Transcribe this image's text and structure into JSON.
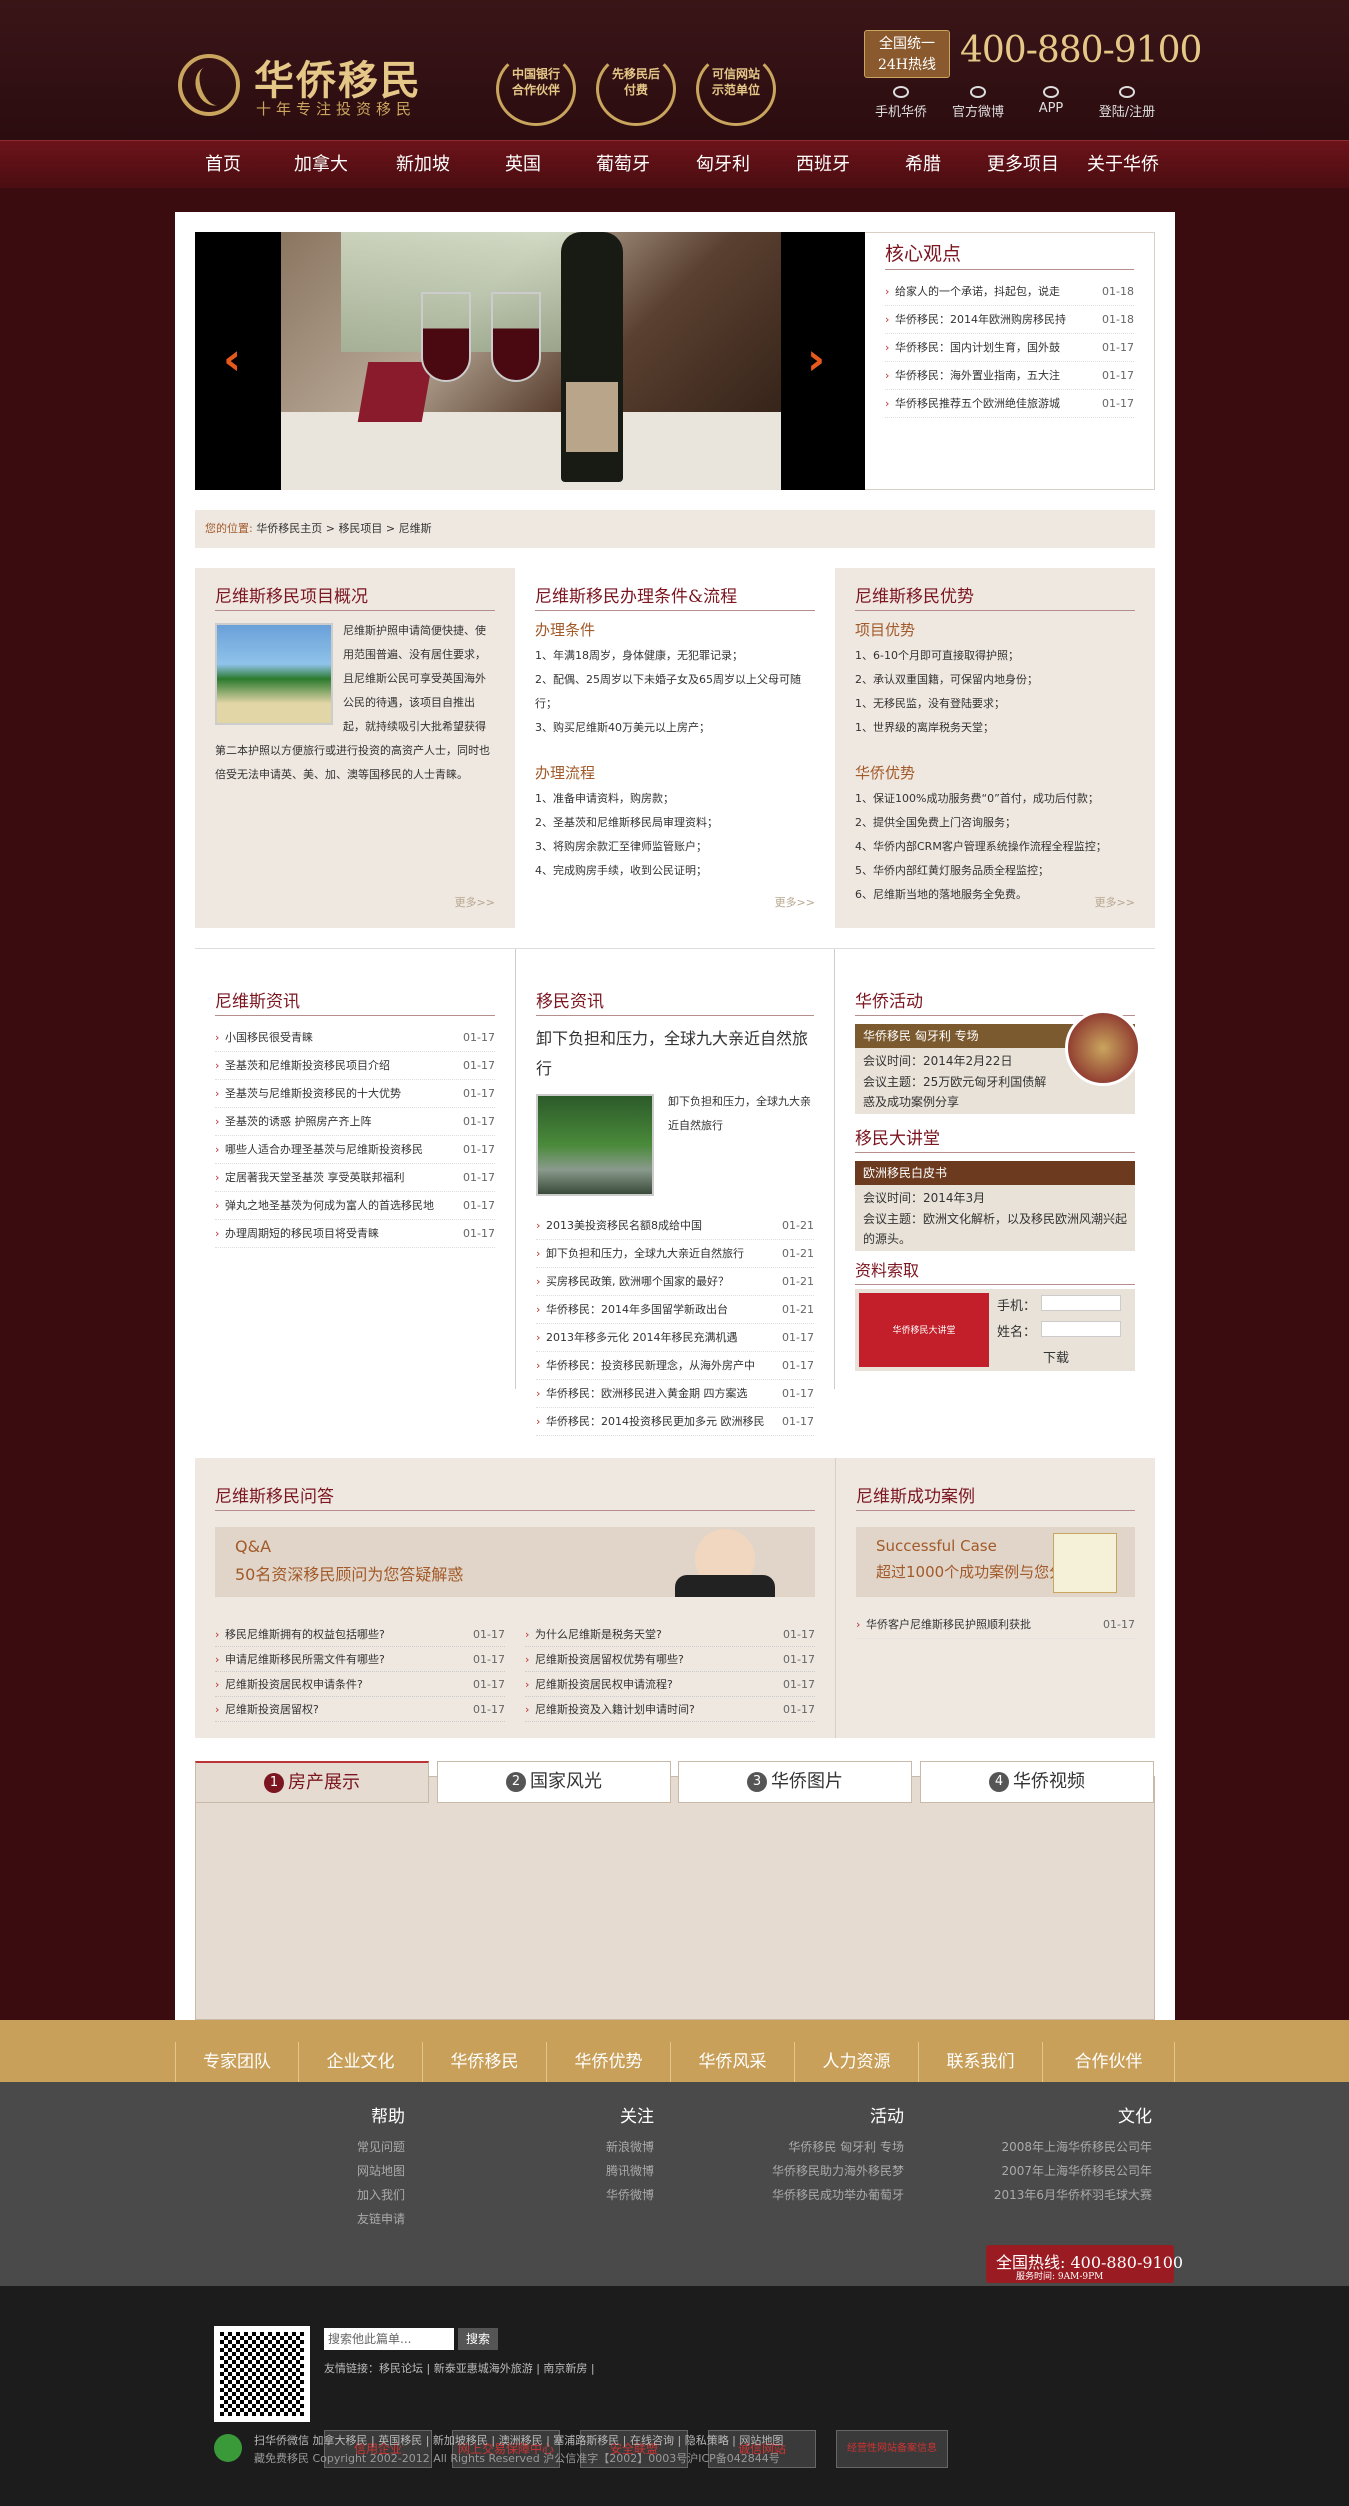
{
  "header": {
    "logo_title": "华侨移民",
    "logo_sub": "十年专注投资移民",
    "badges": [
      "中国银行合作伙伴",
      "先移民后付费",
      "可信网站示范单位"
    ],
    "hotline_label": "全国统一 24H热线",
    "hotline": "400-880-9100",
    "links": [
      "手机华侨",
      "官方微博",
      "APP",
      "登陆/注册"
    ]
  },
  "nav": [
    "首页",
    "加拿大",
    "新加坡",
    "英国",
    "葡萄牙",
    "匈牙利",
    "西班牙",
    "希腊",
    "更多项目",
    "关于华侨"
  ],
  "core": {
    "title": "核心观点",
    "items": [
      {
        "t": "给家人的一个承诺，抖起包，说走",
        "d": "01-18"
      },
      {
        "t": "华侨移民：2014年欧洲购房移民持",
        "d": "01-18"
      },
      {
        "t": "华侨移民：国内计划生育，国外鼓",
        "d": "01-17"
      },
      {
        "t": "华侨移民：海外置业指南，五大注",
        "d": "01-17"
      },
      {
        "t": "华侨移民推荐五个欧洲绝佳旅游城",
        "d": "01-17"
      }
    ]
  },
  "crumb": {
    "label": "您的位置:",
    "path": [
      "华侨移民主页",
      "移民项目",
      "尼维斯"
    ]
  },
  "overview": {
    "title": "尼维斯移民项目概况",
    "text": "尼维斯护照申请简便快捷、使用范围普遍、没有居住要求，且尼维斯公民可享受英国海外公民的待遇，该项目自推出起，就持续吸引大批希望获得第二本护照以方便旅行或进行投资的高资产人士，同时也倍受无法申请英、美、加、澳等国移民的人士青睐。",
    "more": "更多>>"
  },
  "conditions": {
    "title": "尼维斯移民办理条件&流程",
    "sub1": "办理条件",
    "cond": [
      "1、年满18周岁，身体健康，无犯罪记录；",
      "2、配偶、25周岁以下未婚子女及65周岁以上父母可随行；",
      "3、购买尼维斯40万美元以上房产；"
    ],
    "sub2": "办理流程",
    "flow": [
      "1、准备申请资料，购房款；",
      "2、圣基茨和尼维斯移民局审理资料；",
      "3、将购房余款汇至律师监管账户；",
      "4、完成购房手续，收到公民证明；"
    ],
    "more": "更多>>"
  },
  "advantages": {
    "title": "尼维斯移民优势",
    "sub1": "项目优势",
    "proj": [
      "1、6-10个月即可直接取得护照；",
      "2、承认双重国籍，可保留内地身份；",
      "1、无移民监，没有登陆要求；",
      "1、世界级的离岸税务天堂；"
    ],
    "sub2": "华侨优势",
    "qiao": [
      "1、保证100%成功服务费“0”首付，成功后付款；",
      "2、提供全国免费上门咨询服务；",
      "4、华侨内部CRM客户管理系统操作流程全程监控；",
      "5、华侨内部红黄灯服务品质全程监控；",
      "6、尼维斯当地的落地服务全免费。"
    ],
    "more": "更多>>"
  },
  "nevis_news": {
    "title": "尼维斯资讯",
    "items": [
      {
        "t": "小国移民很受青睐",
        "d": "01-17"
      },
      {
        "t": "圣基茨和尼维斯投资移民项目介绍",
        "d": "01-17"
      },
      {
        "t": "圣基茨与尼维斯投资移民的十大优势",
        "d": "01-17"
      },
      {
        "t": "圣基茨的诱惑 护照房产齐上阵",
        "d": "01-17"
      },
      {
        "t": "哪些人适合办理圣基茨与尼维斯投资移民",
        "d": "01-17"
      },
      {
        "t": "定居著我天堂圣基茨 享受英联邦福利",
        "d": "01-17"
      },
      {
        "t": "弹丸之地圣基茨为何成为富人的首选移民地",
        "d": "01-17"
      },
      {
        "t": "办理周期短的移民项目将受青睐",
        "d": "01-17"
      }
    ]
  },
  "immig_news": {
    "title": "移民资讯",
    "headline": "卸下负担和压力，全球九大亲近自然旅行",
    "summary": "卸下负担和压力，全球九大亲近自然旅行",
    "items": [
      {
        "t": "2013美投资移民名额8成给中国",
        "d": "01-21"
      },
      {
        "t": "卸下负担和压力，全球九大亲近自然旅行",
        "d": "01-21"
      },
      {
        "t": "买房移民政策, 欧洲哪个国家的最好？",
        "d": "01-21"
      },
      {
        "t": "华侨移民：2014年多国留学新政出台",
        "d": "01-21"
      },
      {
        "t": "2013年移多元化 2014年移民充满机遇",
        "d": "01-17"
      },
      {
        "t": "华侨移民：投资移民新理念，从海外房产中",
        "d": "01-17"
      },
      {
        "t": "华侨移民：欧洲移民进入黄金期 四方案选",
        "d": "01-17"
      },
      {
        "t": "华侨移民：2014投资移民更加多元 欧洲移民",
        "d": "01-17"
      }
    ]
  },
  "activity": {
    "title": "华侨活动",
    "head": "华侨移民 匈牙利 专场",
    "time": "会议时间：2014年2月22日",
    "theme": "会议主题：25万欧元匈牙利国债解惑及成功案例分享"
  },
  "lecture": {
    "title": "移民大讲堂",
    "head": "欧洲移民白皮书",
    "time": "会议时间：2014年3月",
    "theme": "会议主题：欧洲文化解析，以及移民欧洲风潮兴起的源头。"
  },
  "download": {
    "title": "资料索取",
    "cover": "华侨移民大讲堂",
    "phone": "手机：",
    "name": "姓名：",
    "button": "下载"
  },
  "qa": {
    "title": "尼维斯移民问答",
    "b1": "Q&A",
    "b2": "50名资深移民顾问为您答疑解惑",
    "left": [
      {
        "t": "移民尼维斯拥有的权益包括哪些?",
        "d": "01-17"
      },
      {
        "t": "申请尼维斯移民所需文件有哪些?",
        "d": "01-17"
      },
      {
        "t": "尼维斯投资居民权申请条件?",
        "d": "01-17"
      },
      {
        "t": "尼维斯投资居留权?",
        "d": "01-17"
      }
    ],
    "right": [
      {
        "t": "为什么尼维斯是税务天堂?",
        "d": "01-17"
      },
      {
        "t": "尼维斯投资居留权优势有哪些?",
        "d": "01-17"
      },
      {
        "t": "尼维斯投资居民权申请流程?",
        "d": "01-17"
      },
      {
        "t": "尼维斯投资及入籍计划申请时间?",
        "d": "01-17"
      }
    ]
  },
  "cases": {
    "title": "尼维斯成功案例",
    "b1": "Successful Case",
    "b2": "超过1000个成功案例与您分享",
    "items": [
      {
        "t": "华侨客户尼维斯移民护照顺利获批",
        "d": "01-17"
      }
    ]
  },
  "tabs": [
    {
      "n": "1",
      "label": "房产展示"
    },
    {
      "n": "2",
      "label": "国家风光"
    },
    {
      "n": "3",
      "label": "华侨图片"
    },
    {
      "n": "4",
      "label": "华侨视频"
    }
  ],
  "goldbar": [
    "专家团队",
    "企业文化",
    "华侨移民",
    "华侨优势",
    "华侨风采",
    "人力资源",
    "联系我们",
    "合作伙伴"
  ],
  "footer": {
    "cols": [
      {
        "h": "帮助",
        "items": [
          "常见问题",
          "网站地图",
          "加入我们",
          "友链申请"
        ]
      },
      {
        "h": "关注",
        "items": [
          "新浪微博",
          "腾讯微博",
          "华侨微博"
        ]
      },
      {
        "h": "活动",
        "items": [
          "华侨移民 匈牙利 专场",
          "华侨移民助力海外移民梦",
          "华侨移民成功举办葡萄牙"
        ]
      },
      {
        "h": "文化",
        "items": [
          "2008年上海华侨移民公司年",
          "2007年上海华侨移民公司年",
          "2013年6月华侨杯羽毛球大赛"
        ]
      }
    ],
    "hotline": "全国热线: 400-880-9100",
    "hours": "服务时间: 9AM-9PM",
    "search_placeholder": "搜索他此篇单...",
    "search_btn": "搜索",
    "friends": "友情链接：移民论坛 | 新泰亚惠城海外旅游 | 南京新房 |",
    "certs": [
      "信用企业",
      "网上交易保障中心",
      "安全联盟",
      "诚信网站",
      "经营性网站备案信息"
    ],
    "links": "扫华侨微信 加拿大移民 | 英国移民 | 新加坡移民 | 澳洲移民 | 塞浦路斯移民 | 在线咨询 | 隐私策略 | 网站地图",
    "copyright": "藏免费移民 Copyright 2002-2012 All Rights Reserved 沪公信准字【2002】0003号沪ICP备042844号"
  }
}
